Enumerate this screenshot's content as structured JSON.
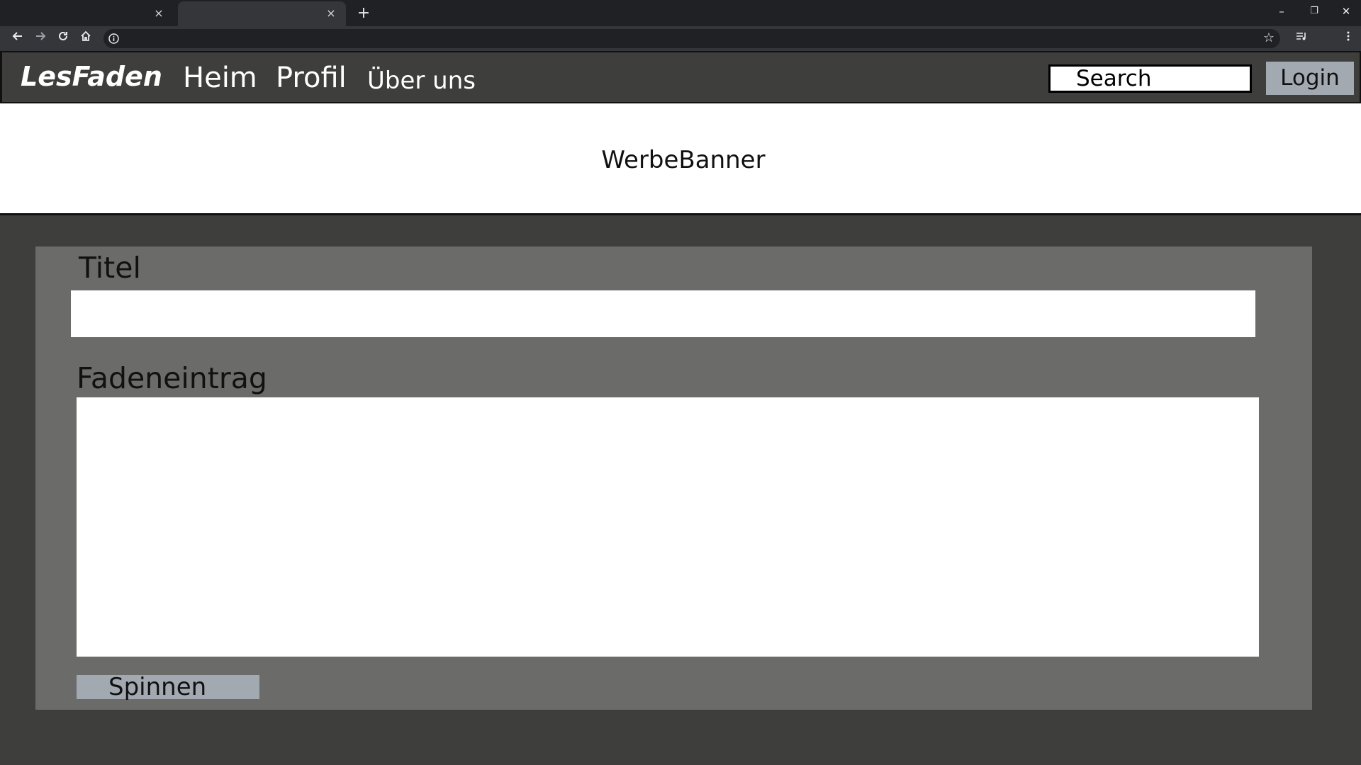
{
  "browser": {
    "tabs": [
      {
        "title": "",
        "close_icon": "close-icon"
      },
      {
        "title": "",
        "close_icon": "close-icon"
      }
    ],
    "new_tab_glyph": "+",
    "url": "",
    "window_controls": {
      "minimize": "–",
      "restore": "❐",
      "close": "✕"
    }
  },
  "header": {
    "brand": "LesFaden",
    "nav": [
      {
        "label": "Heim"
      },
      {
        "label": "Profil"
      },
      {
        "label": "Über uns"
      }
    ],
    "search_placeholder": "Search",
    "login_label": "Login"
  },
  "banner": {
    "text": "WerbeBanner"
  },
  "form": {
    "title_label": "Titel",
    "title_value": "",
    "entry_label": "Fadeneintrag",
    "entry_value": "",
    "submit_label": "Spinnen"
  },
  "colors": {
    "header_bg": "#3e3e3d",
    "panel_bg": "#6b6b69",
    "button_bg": "#a3a9b0",
    "chrome_dark": "#202124",
    "chrome_toolbar": "#35363a"
  }
}
